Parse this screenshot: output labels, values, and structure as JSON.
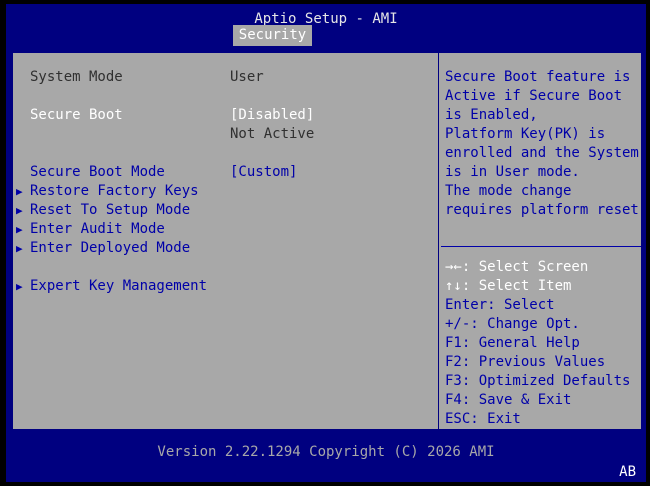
{
  "header": {
    "title": "Aptio Setup - AMI",
    "tab": "Security"
  },
  "settings": {
    "system_mode": {
      "label": "System Mode",
      "value": "User"
    },
    "secure_boot": {
      "label": "Secure Boot",
      "value": "[Disabled]",
      "status": "Not Active"
    },
    "secure_boot_mode": {
      "label": "Secure Boot Mode",
      "value": "[Custom]"
    }
  },
  "submenus": [
    "Restore Factory Keys",
    "Reset To Setup Mode",
    "Enter Audit Mode",
    "Enter Deployed Mode",
    "Expert Key Management"
  ],
  "help_text": [
    "Secure Boot feature is",
    "Active if Secure Boot",
    "is Enabled,",
    "Platform Key(PK) is",
    "enrolled and the System",
    "is in User mode.",
    "The mode change",
    "requires platform reset"
  ],
  "keys": [
    "→←: Select Screen",
    "↑↓: Select Item",
    "Enter: Select",
    "+/-: Change Opt.",
    "F1: General Help",
    "F2: Previous Values",
    "F3: Optimized Defaults",
    "F4: Save & Exit",
    "ESC: Exit"
  ],
  "footer": "Version 2.22.1294 Copyright (C) 2026 AMI",
  "corner_badge": "AB",
  "icons": {
    "submenu": "triangle-right-icon"
  },
  "colors": {
    "background": "#000080",
    "panel": "#a8a8a8",
    "text_blue": "#0000a8",
    "highlight": "#ffffff"
  }
}
